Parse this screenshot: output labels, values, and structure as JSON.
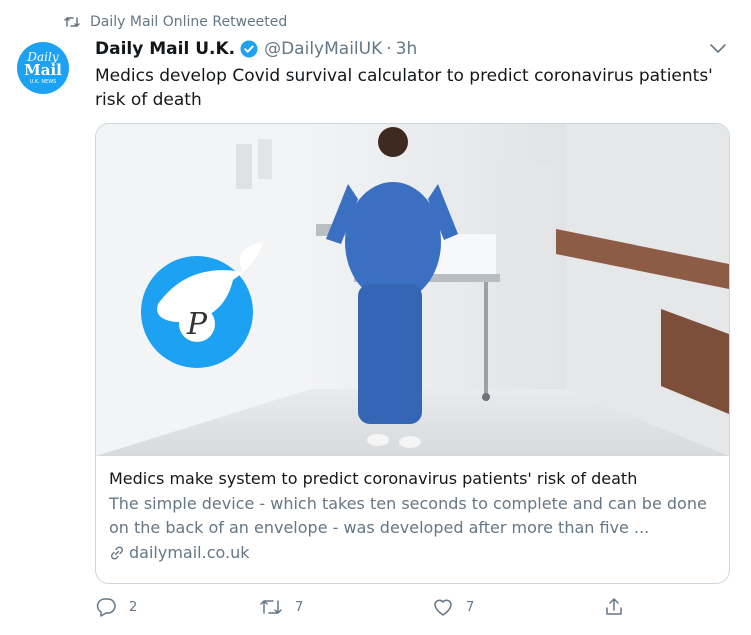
{
  "retweet": {
    "label": "Daily Mail Online Retweeted"
  },
  "avatar": {
    "line1": "Daily",
    "line2": "Mail",
    "line3": "U.K. NEWS"
  },
  "tweet": {
    "name": "Daily Mail U.K.",
    "handle": "@DailyMailUK",
    "separator": "·",
    "time": "3h",
    "text": "Medics develop Covid survival calculator to predict coronavirus patients' risk of death"
  },
  "card": {
    "title": "Medics make system to predict coronavirus patients' risk of death",
    "description": "The simple device - which takes ten seconds to complete and can be done on the back of an envelope - was developed after more than five ...",
    "domain": "dailymail.co.uk",
    "watermark_letter": "P"
  },
  "actions": {
    "reply_count": "2",
    "retweet_count": "7",
    "like_count": "7"
  },
  "colors": {
    "accent": "#1da1f2",
    "secondary_text": "#657786",
    "border": "#ccd6dd",
    "scrubs": "#3a6fc1"
  }
}
